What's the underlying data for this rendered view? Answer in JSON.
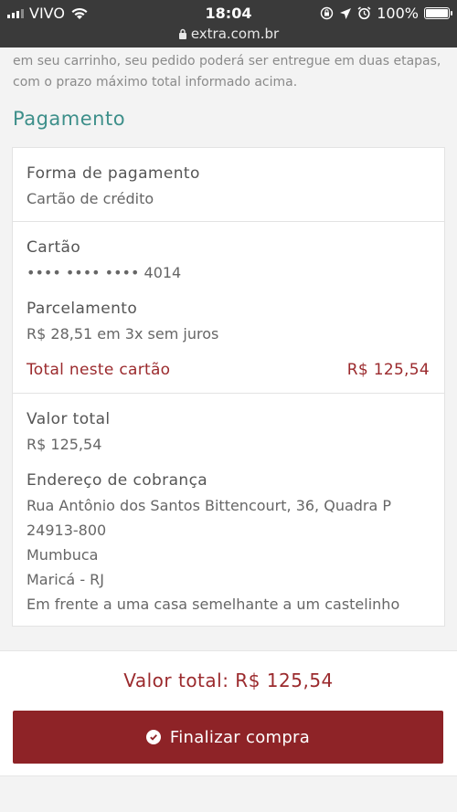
{
  "status_bar": {
    "carrier": "VIVO",
    "time": "18:04",
    "url": "extra.com.br",
    "battery_percent": "100%",
    "icons": [
      "signal-icon",
      "wifi-icon",
      "lock-icon",
      "screen-rotation-lock-icon",
      "location-icon",
      "alarm-icon",
      "battery-icon"
    ]
  },
  "note": "em seu carrinho, seu pedido poderá ser entregue em duas etapas, com o prazo máximo total informado acima.",
  "section_title": "Pagamento",
  "payment": {
    "method_label": "Forma de pagamento",
    "method_value": "Cartão de crédito",
    "card_label": "Cartão",
    "card_value": "•••• •••• •••• 4014",
    "installments_label": "Parcelamento",
    "installments_value": "R$ 28,51 em 3x sem juros",
    "card_total_label": "Total neste cartão",
    "card_total_value": "R$ 125,54",
    "total_label": "Valor total",
    "total_value": "R$ 125,54",
    "billing_label": "Endereço de cobrança",
    "billing_lines": [
      "Rua Antônio dos Santos Bittencourt, 36, Quadra P",
      "24913-800",
      "Mumbuca",
      "Maricá - RJ",
      "Em frente a uma casa semelhante a um castelinho"
    ]
  },
  "footer": {
    "grand_total": "Valor total: R$ 125,54",
    "finish_button": "Finalizar compra"
  },
  "colors": {
    "accent_teal": "#3d8f8a",
    "brand_red": "#8e2327",
    "price_red": "#9b2a2d"
  }
}
